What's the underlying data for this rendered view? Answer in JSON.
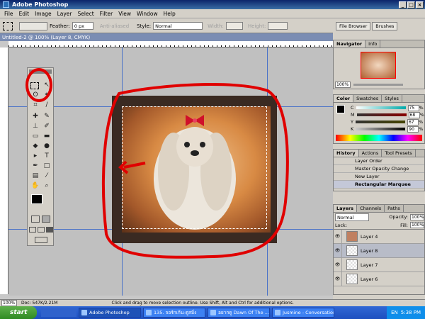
{
  "window": {
    "title": "Adobe Photoshop"
  },
  "menu": [
    "File",
    "Edit",
    "Image",
    "Layer",
    "Select",
    "Filter",
    "View",
    "Window",
    "Help"
  ],
  "options": {
    "feather_label": "Feather:",
    "feather_value": "0 px",
    "antialias_label": "Anti-aliased",
    "style_label": "Style:",
    "style_value": "Normal",
    "width_label": "Width:",
    "height_label": "Height:"
  },
  "palette_well": {
    "file_browser": "File Browser",
    "brushes": "Brushes"
  },
  "document": {
    "title": "Untitled-2 @ 100% (Layer 8, CMYK)"
  },
  "navigator": {
    "tabs": [
      "Navigator",
      "Info"
    ],
    "zoom": "100%"
  },
  "color": {
    "tabs": [
      "Color",
      "Swatches",
      "Styles"
    ],
    "channels": [
      {
        "label": "C",
        "value": "75",
        "pct": "%"
      },
      {
        "label": "M",
        "value": "68",
        "pct": "%"
      },
      {
        "label": "Y",
        "value": "67",
        "pct": "%"
      },
      {
        "label": "K",
        "value": "90",
        "pct": "%"
      }
    ]
  },
  "history": {
    "tabs": [
      "History",
      "Actions",
      "Tool Presets"
    ],
    "items": [
      "Layer Order",
      "Master Opacity Change",
      "New Layer",
      "Rectangular Marquee"
    ]
  },
  "layers": {
    "tabs": [
      "Layers",
      "Channels",
      "Paths"
    ],
    "blend_mode": "Normal",
    "opacity_label": "Opacity:",
    "opacity_value": "100%",
    "lock_label": "Lock:",
    "fill_label": "Fill:",
    "fill_value": "100%",
    "items": [
      "Layer 4",
      "Layer 8",
      "Layer 7",
      "Layer 6"
    ]
  },
  "status": {
    "zoom": "100%",
    "doc": "Doc: 547K/2.21M",
    "hint": "Click and drag to move selection outline. Use Shift, Alt and Ctrl for additional options."
  },
  "taskbar": {
    "start": "start",
    "tasks": [
      "Adobe Photoshop",
      "135. จอร์กเก้น-ดูสมิ่ง",
      "อยากดู Dawn Of The ...",
      "Jusmine - Conversation"
    ],
    "lang": "EN",
    "clock": "5:38 PM"
  },
  "colors": {
    "annotation": "#e00000",
    "accent": "#0a246a"
  }
}
